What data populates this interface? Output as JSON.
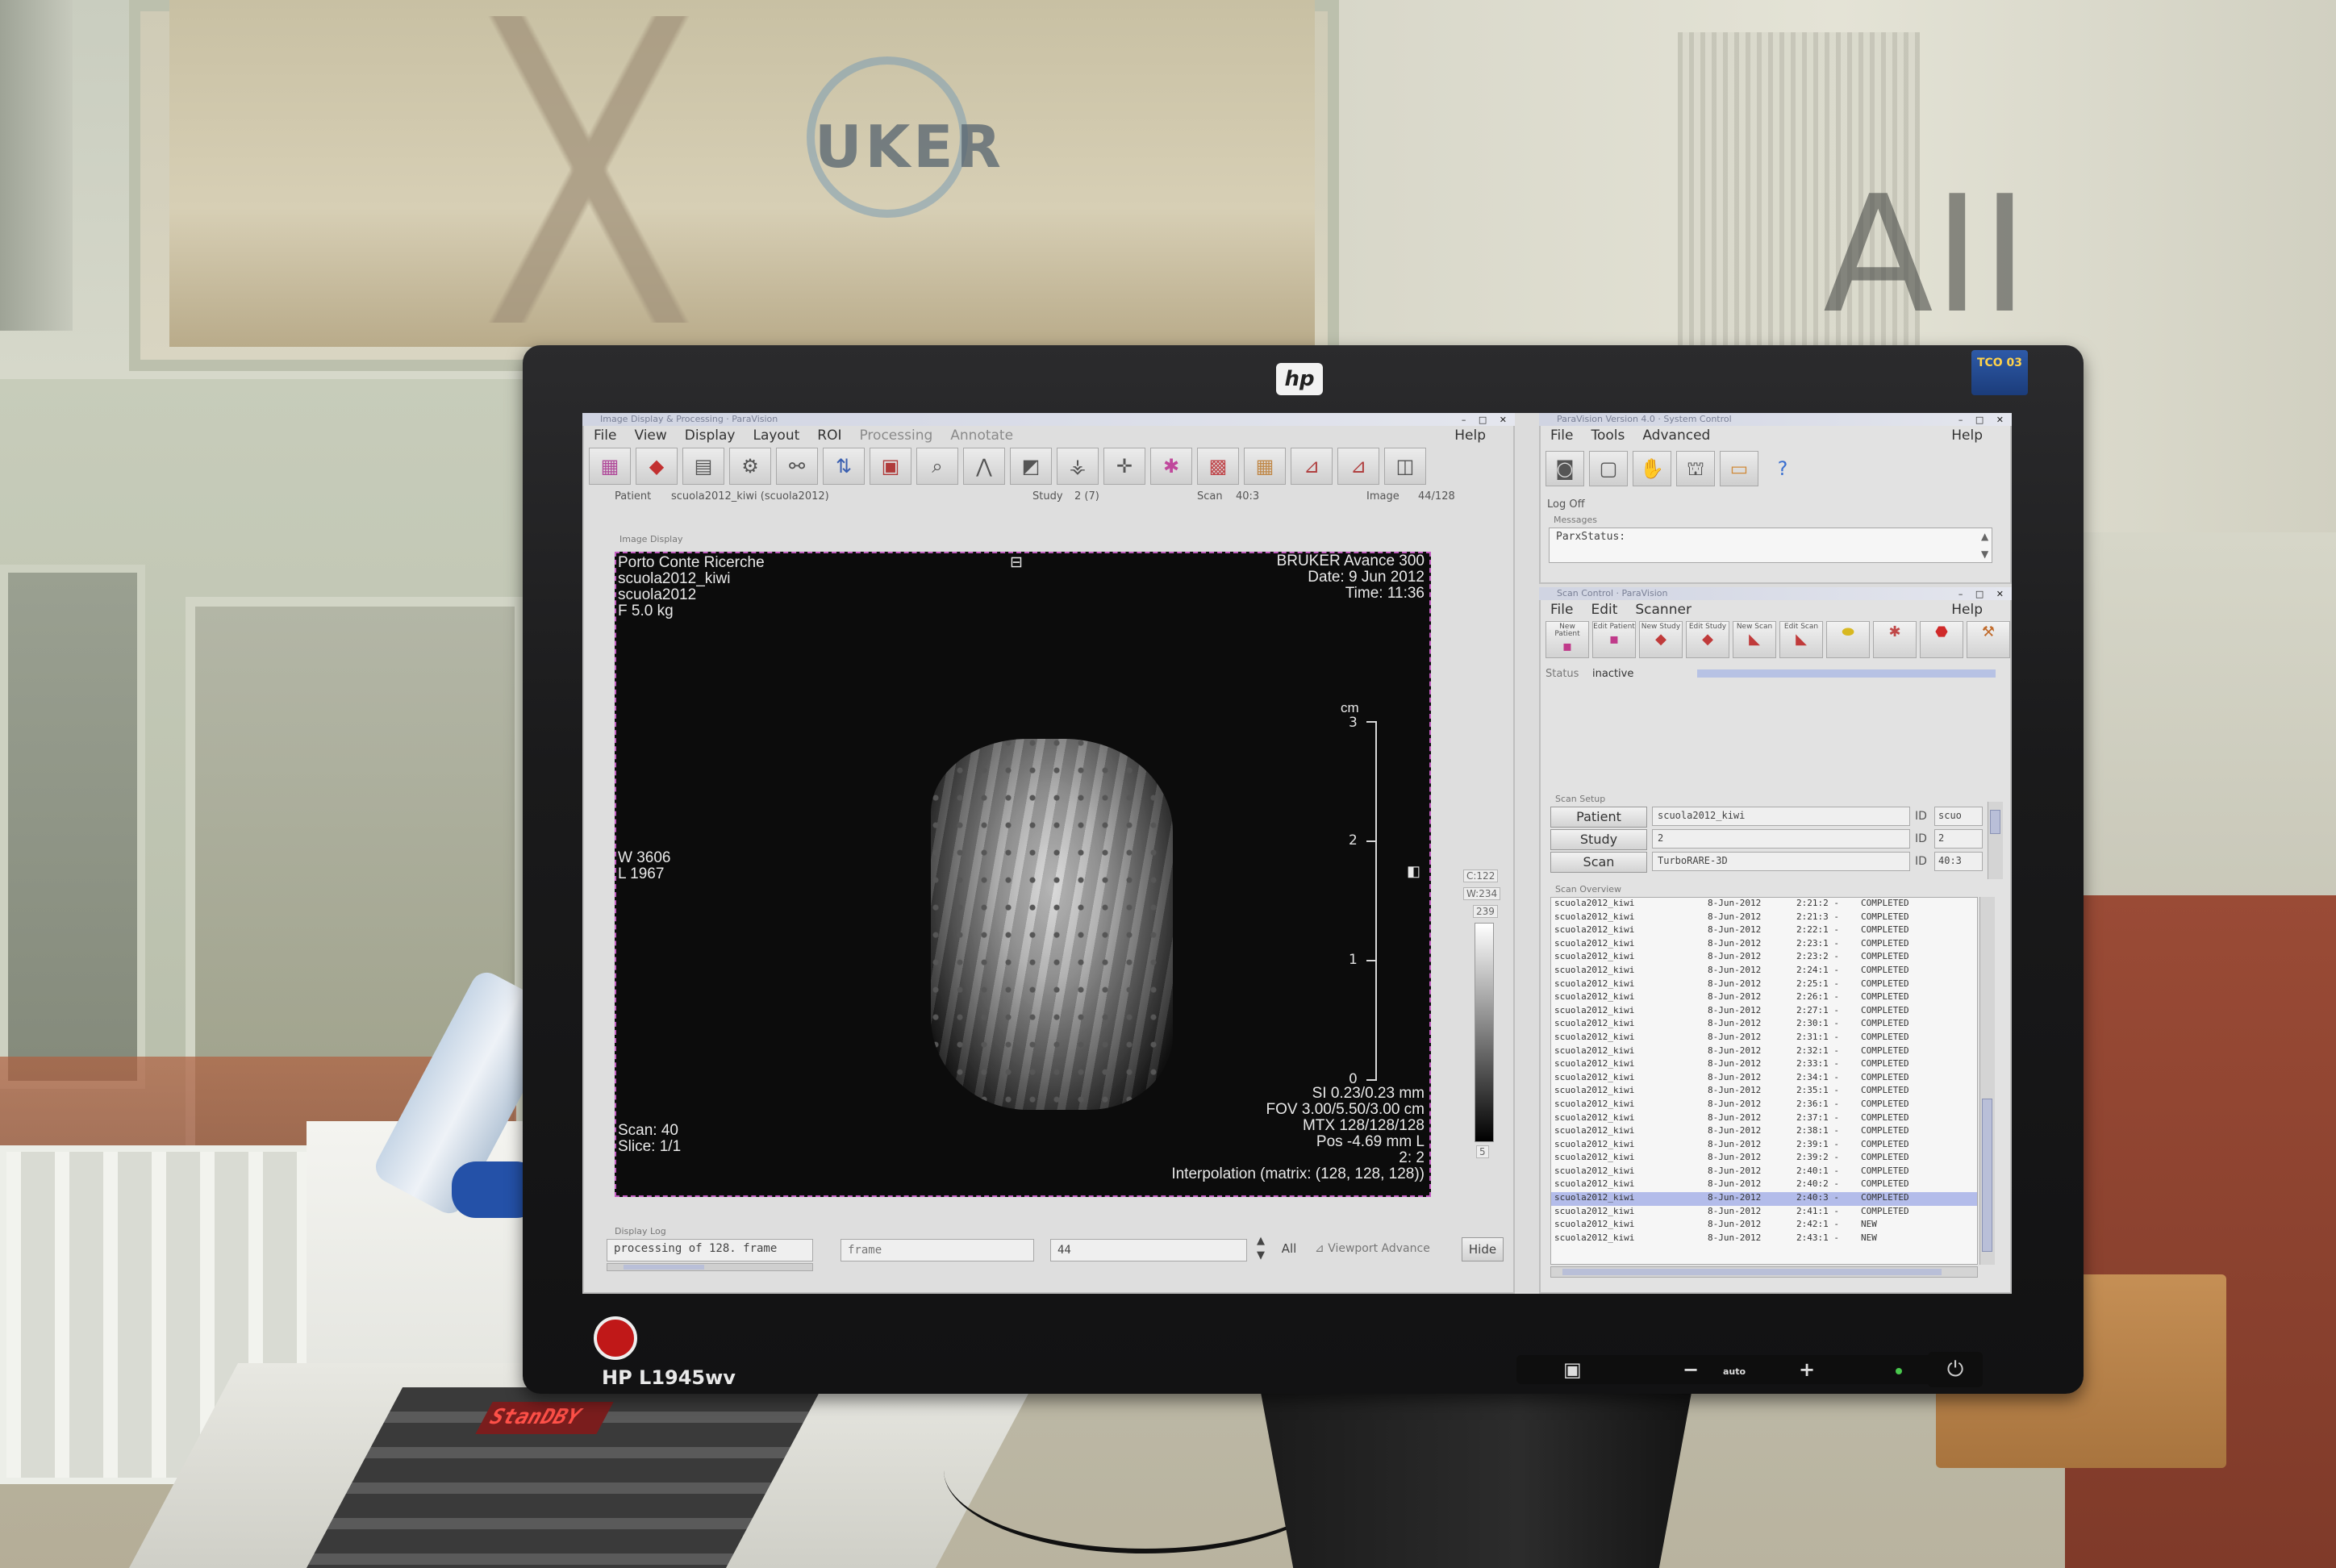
{
  "monitor": {
    "brand_logo": "hp",
    "model": "HP L1945wv",
    "energy_badge": "TCO 03",
    "ctrl_minus": "−",
    "ctrl_auto": "auto",
    "ctrl_plus": "+",
    "power_icon": "⏻"
  },
  "background": {
    "logo_text": "UKER",
    "letters": "AII",
    "keypad_display": "StanDBY"
  },
  "image_window": {
    "title": "Image Display & Processing · ParaVision",
    "menu": [
      "File",
      "View",
      "Display",
      "Layout",
      "ROI",
      "Processing",
      "Annotate"
    ],
    "help": "Help",
    "toolbar_icons": [
      "overview-icon",
      "shoe-icon",
      "book-icon",
      "gear-icon",
      "link-icon",
      "adjust-icon",
      "frame-icon",
      "zoom-icon",
      "tripod-icon",
      "cube-icon",
      "film-icon",
      "crosshair-icon",
      "roi-icon",
      "grid-icon",
      "grid2-icon",
      "graph-icon",
      "graph2-icon",
      "screenshot-icon"
    ],
    "info": {
      "patient_label": "Patient",
      "patient_value": "scuola2012_kiwi (scuola2012)",
      "study_label": "Study",
      "study_value": "2 (7)",
      "scan_label": "Scan",
      "scan_value": "40:3",
      "image_label": "Image",
      "image_value": "44/128"
    },
    "group_label": "Image Display",
    "overlay": {
      "top_left": [
        "Porto Conte Ricerche",
        "scuola2012_kiwi",
        "scuola2012",
        "F 5.0 kg"
      ],
      "top_right": [
        "BRUKER Avance 300",
        "Date: 9 Jun 2012",
        "Time: 11:36"
      ],
      "wl": [
        "W 3606",
        "L 1967"
      ],
      "scan_slice": [
        "Scan: 40",
        "Slice: 1/1"
      ],
      "bottom_right": [
        "SI 0.23/0.23 mm",
        "FOV 3.00/5.50/3.00 cm",
        "MTX 128/128/128",
        "Pos -4.69 mm L",
        "2: 2",
        "Interpolation (matrix: (128, 128, 128))"
      ],
      "scale_unit": "cm",
      "scale_ticks": [
        "3",
        "2",
        "1",
        "0"
      ]
    },
    "side_labels": [
      "C:122",
      "W:234",
      "239",
      "5"
    ],
    "display_log_label": "Display Log",
    "log_text": "processing of 128. frame",
    "frame_placeholder": "frame",
    "frame_value": "44",
    "all_btn": "All",
    "viewport_advance": "Viewport Advance",
    "hide_btn": "Hide"
  },
  "system_window": {
    "title": "ParaVision Version 4.0 · System Control",
    "menu": [
      "File",
      "Tools",
      "Advanced"
    ],
    "help": "Help",
    "toolbar_icons": [
      "camera-icon",
      "capture-icon",
      "hand-icon",
      "magnet-icon",
      "monitor-icon",
      "help-icon"
    ],
    "log_status": "Log Off",
    "messages_label": "Messages",
    "messages_text": "ParxStatus:"
  },
  "scan_window": {
    "title": "Scan Control · ParaVision",
    "menu": [
      "File",
      "Edit",
      "Scanner"
    ],
    "help": "Help",
    "buttons": [
      {
        "label": "New Patient",
        "icon": "new-patient-icon"
      },
      {
        "label": "Edit Patient",
        "icon": "edit-patient-icon"
      },
      {
        "label": "New Study",
        "icon": "new-study-icon"
      },
      {
        "label": "Edit Study",
        "icon": "edit-study-icon"
      },
      {
        "label": "New Scan",
        "icon": "new-scan-icon"
      },
      {
        "label": "Edit Scan",
        "icon": "edit-scan-icon"
      },
      {
        "label": "",
        "icon": "traffic-icon"
      },
      {
        "label": "",
        "icon": "runner-icon"
      },
      {
        "label": "",
        "icon": "stop-icon"
      },
      {
        "label": "",
        "icon": "wrench-icon"
      }
    ],
    "status_label": "Status",
    "status_value": "inactive",
    "setup_label": "Scan Setup",
    "setup": [
      {
        "btn": "Patient",
        "value": "scuola2012_kiwi",
        "id_label": "ID",
        "id_value": "scuo"
      },
      {
        "btn": "Study",
        "value": "2",
        "id_label": "ID",
        "id_value": "2"
      },
      {
        "btn": "Scan",
        "value": "TurboRARE-3D",
        "id_label": "ID",
        "id_value": "40:3"
      }
    ],
    "overview_label": "Scan Overview",
    "scans": [
      [
        "scuola2012_kiwi",
        "8-Jun-2012",
        "2:21:2 -",
        "COMPLETED"
      ],
      [
        "scuola2012_kiwi",
        "8-Jun-2012",
        "2:21:3 -",
        "COMPLETED"
      ],
      [
        "scuola2012_kiwi",
        "8-Jun-2012",
        "2:22:1 -",
        "COMPLETED"
      ],
      [
        "scuola2012_kiwi",
        "8-Jun-2012",
        "2:23:1 -",
        "COMPLETED"
      ],
      [
        "scuola2012_kiwi",
        "8-Jun-2012",
        "2:23:2 -",
        "COMPLETED"
      ],
      [
        "scuola2012_kiwi",
        "8-Jun-2012",
        "2:24:1 -",
        "COMPLETED"
      ],
      [
        "scuola2012_kiwi",
        "8-Jun-2012",
        "2:25:1 -",
        "COMPLETED"
      ],
      [
        "scuola2012_kiwi",
        "8-Jun-2012",
        "2:26:1 -",
        "COMPLETED"
      ],
      [
        "scuola2012_kiwi",
        "8-Jun-2012",
        "2:27:1 -",
        "COMPLETED"
      ],
      [
        "scuola2012_kiwi",
        "8-Jun-2012",
        "2:30:1 -",
        "COMPLETED"
      ],
      [
        "scuola2012_kiwi",
        "8-Jun-2012",
        "2:31:1 -",
        "COMPLETED"
      ],
      [
        "scuola2012_kiwi",
        "8-Jun-2012",
        "2:32:1 -",
        "COMPLETED"
      ],
      [
        "scuola2012_kiwi",
        "8-Jun-2012",
        "2:33:1 -",
        "COMPLETED"
      ],
      [
        "scuola2012_kiwi",
        "8-Jun-2012",
        "2:34:1 -",
        "COMPLETED"
      ],
      [
        "scuola2012_kiwi",
        "8-Jun-2012",
        "2:35:1 -",
        "COMPLETED"
      ],
      [
        "scuola2012_kiwi",
        "8-Jun-2012",
        "2:36:1 -",
        "COMPLETED"
      ],
      [
        "scuola2012_kiwi",
        "8-Jun-2012",
        "2:37:1 -",
        "COMPLETED"
      ],
      [
        "scuola2012_kiwi",
        "8-Jun-2012",
        "2:38:1 -",
        "COMPLETED"
      ],
      [
        "scuola2012_kiwi",
        "8-Jun-2012",
        "2:39:1 -",
        "COMPLETED"
      ],
      [
        "scuola2012_kiwi",
        "8-Jun-2012",
        "2:39:2 -",
        "COMPLETED"
      ],
      [
        "scuola2012_kiwi",
        "8-Jun-2012",
        "2:40:1 -",
        "COMPLETED"
      ],
      [
        "scuola2012_kiwi",
        "8-Jun-2012",
        "2:40:2 -",
        "COMPLETED"
      ],
      [
        "scuola2012_kiwi",
        "8-Jun-2012",
        "2:40:3 -",
        "COMPLETED"
      ],
      [
        "scuola2012_kiwi",
        "8-Jun-2012",
        "2:41:1 -",
        "COMPLETED"
      ],
      [
        "scuola2012_kiwi",
        "8-Jun-2012",
        "2:42:1 -",
        "NEW"
      ],
      [
        "scuola2012_kiwi",
        "8-Jun-2012",
        "2:43:1 -",
        "NEW"
      ]
    ],
    "selected_index": 22
  }
}
